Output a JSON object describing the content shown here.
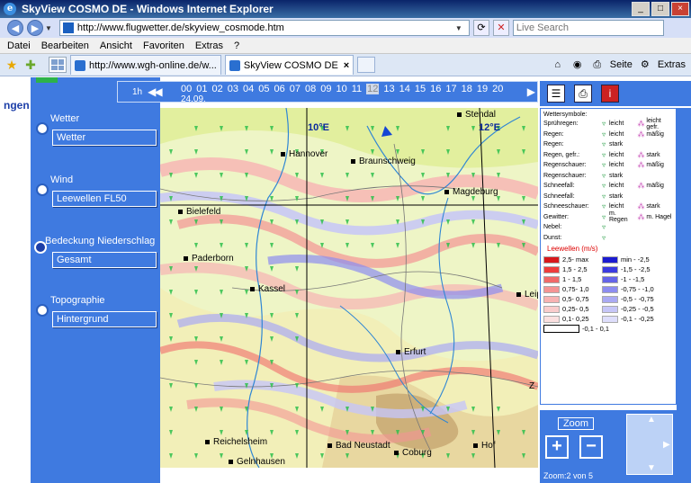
{
  "window": {
    "title": "SkyView COSMO DE - Windows Internet Explorer",
    "min": "_",
    "max": "□",
    "close": "×"
  },
  "address": {
    "url": "http://www.flugwetter.de/skyview_cosmode.htm",
    "search_placeholder": "Live Search"
  },
  "menu": [
    "Datei",
    "Bearbeiten",
    "Ansicht",
    "Favoriten",
    "Extras",
    "?"
  ],
  "tabs": [
    {
      "label": "http://www.wgh-online.de/w...",
      "active": false
    },
    {
      "label": "SkyView COSMO DE",
      "active": true
    }
  ],
  "toolbar_right": {
    "seite": "Seite",
    "extras": "Extras"
  },
  "left_panel": {
    "cut_label": "ngen",
    "groups": [
      {
        "label": "Wetter",
        "value": "Wetter",
        "selected": false
      },
      {
        "label": "Wind",
        "value": "Leewellen FL50",
        "selected": false
      },
      {
        "label": "Bedeckung  Niederschlag",
        "value": "Gesamt",
        "selected": true
      },
      {
        "label": "Topographie",
        "value": "Hintergrund",
        "selected": false
      }
    ]
  },
  "timebar": {
    "step": "1h",
    "hours": [
      "00",
      "01",
      "02",
      "03",
      "04",
      "05",
      "06",
      "07",
      "08",
      "09",
      "10",
      "11",
      "12",
      "13",
      "14",
      "15",
      "16",
      "17",
      "18",
      "19",
      "20"
    ],
    "selected_hour": "12",
    "date": "24.09."
  },
  "map": {
    "lon_labels": [
      "10°E",
      "12°E"
    ],
    "cities": [
      {
        "name": "Stendal"
      },
      {
        "name": "Hannover"
      },
      {
        "name": "Braunschweig"
      },
      {
        "name": "Magdeburg"
      },
      {
        "name": "Bielefeld"
      },
      {
        "name": "Paderborn"
      },
      {
        "name": "Kassel"
      },
      {
        "name": "Leip"
      },
      {
        "name": "Erfurt"
      },
      {
        "name": "Z"
      },
      {
        "name": "Reichelsheim"
      },
      {
        "name": "Bad Neustadt"
      },
      {
        "name": "Coburg"
      },
      {
        "name": "Hof"
      },
      {
        "name": "Gelnhausen"
      }
    ]
  },
  "legend": {
    "title": "Wettersymbole:",
    "weather": [
      {
        "name": "Sprühregen:",
        "a": "leicht",
        "b": "leicht gefr."
      },
      {
        "name": "Regen:",
        "a": "leicht",
        "b": "mäßig"
      },
      {
        "name": "Regen:",
        "a": "stark",
        "b": ""
      },
      {
        "name": "Regen, gefr.:",
        "a": "leicht",
        "b": "stark"
      },
      {
        "name": "Regenschauer:",
        "a": "leicht",
        "b": "mäßig"
      },
      {
        "name": "Regenschauer:",
        "a": "stark",
        "b": ""
      },
      {
        "name": "Schneefall:",
        "a": "leicht",
        "b": "mäßig"
      },
      {
        "name": "Schneefall:",
        "a": "stark",
        "b": ""
      },
      {
        "name": "Schneeschauer:",
        "a": "leicht",
        "b": "stark"
      },
      {
        "name": "Gewitter:",
        "a": "m. Regen",
        "b": "m. Hagel"
      },
      {
        "name": "Nebel:",
        "a": "",
        "b": ""
      },
      {
        "name": "Dunst:",
        "a": "",
        "b": ""
      }
    ],
    "lee_title": "Leewellen (m/s)",
    "lee_pos": [
      {
        "label": "2,5- max",
        "color": "#d8181c"
      },
      {
        "label": "1,5 - 2,5",
        "color": "#ee3c3c"
      },
      {
        "label": "1 - 1,5",
        "color": "#f06a6a"
      },
      {
        "label": "0,75- 1,0",
        "color": "#f49494"
      },
      {
        "label": "0,5- 0,75",
        "color": "#f7b3b3"
      },
      {
        "label": "0,25- 0,5",
        "color": "#f9cccc"
      },
      {
        "label": "0,1- 0,25",
        "color": "#fbe0e0"
      }
    ],
    "lee_neg": [
      {
        "label": "min - -2,5",
        "color": "#1b1bd0"
      },
      {
        "label": "-1,5 - -2,5",
        "color": "#3b3be0"
      },
      {
        "label": "-1 - -1,5",
        "color": "#6565e8"
      },
      {
        "label": "-0,75 - -1,0",
        "color": "#8d8df0"
      },
      {
        "label": "-0,5 - -0,75",
        "color": "#aaaaf3"
      },
      {
        "label": "-0,25 - -0,5",
        "color": "#c6c6f7"
      },
      {
        "label": "-0,1 - -0,25",
        "color": "#dedefb"
      }
    ],
    "neutral": "-0,1 - 0,1"
  },
  "zoom": {
    "title": "Zoom",
    "plus": "+",
    "minus": "−",
    "status": "Zoom:2 von 5"
  }
}
